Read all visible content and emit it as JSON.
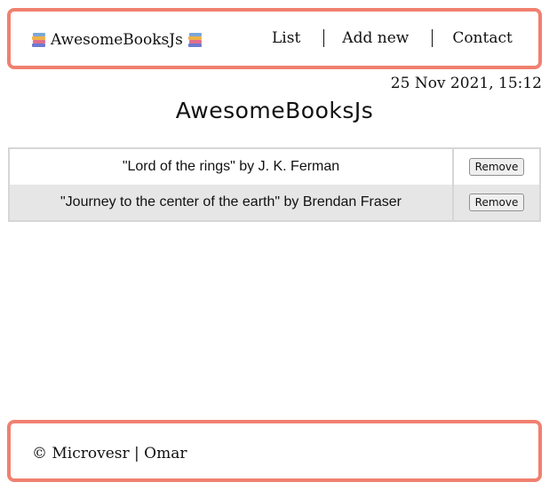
{
  "header": {
    "brand": "AwesomeBooksJs",
    "brand_icon": "books-icon",
    "nav": {
      "list": "List",
      "add_new": "Add new",
      "contact": "Contact"
    }
  },
  "datetime": "25 Nov 2021, 15:12",
  "page_title": "AwesomeBooksJs",
  "books": [
    {
      "title": "\"Lord of the rings\" by J. K. Ferman",
      "action": "Remove"
    },
    {
      "title": "\"Journey to the center of the earth\" by Brendan Fraser",
      "action": "Remove"
    }
  ],
  "footer": {
    "text": "© Microvesr | Omar"
  },
  "colors": {
    "accent_border": "#f08070",
    "alt_row": "#e6e6e6"
  }
}
